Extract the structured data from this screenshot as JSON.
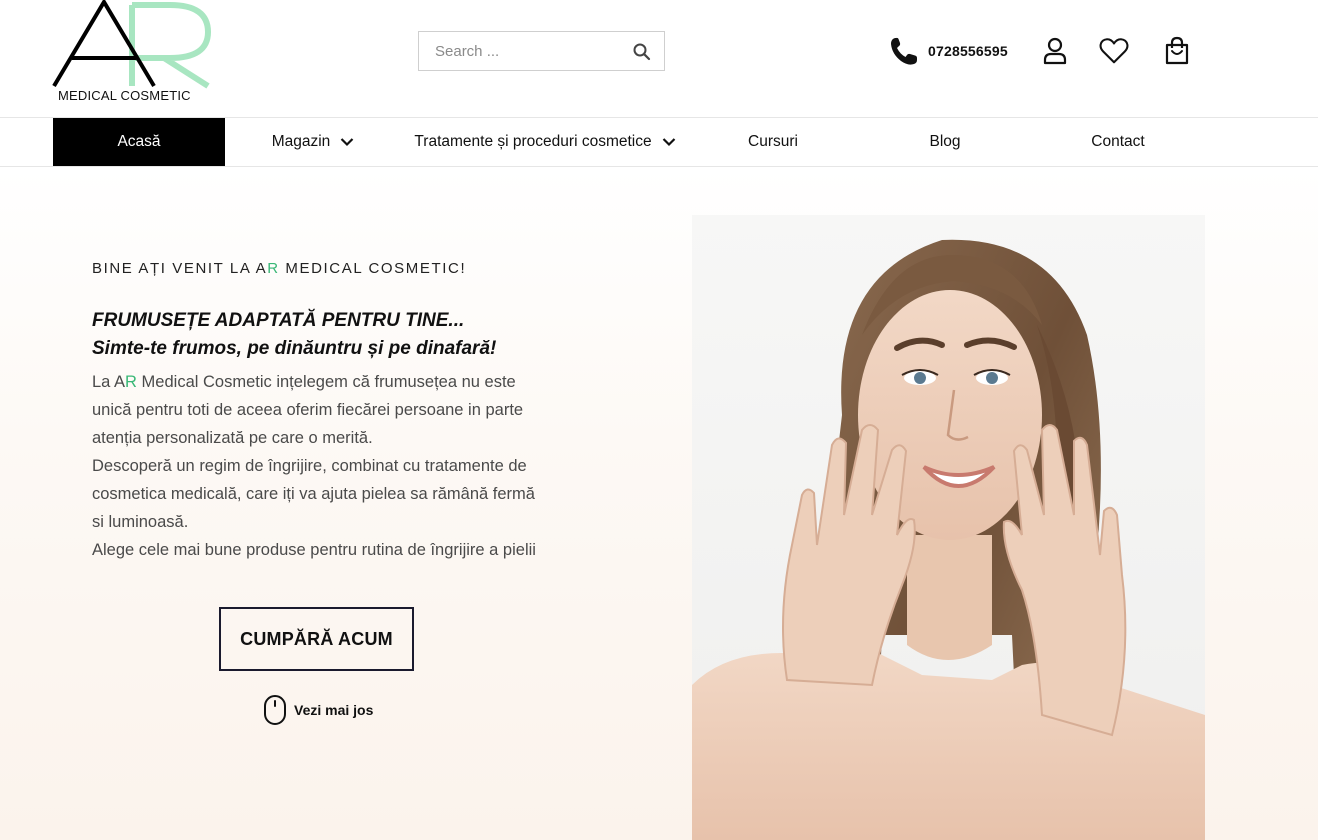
{
  "brand": {
    "logo_letters": "AR",
    "logo_subtitle": "MEDICAL COSMETIC",
    "accent_color": "#a8e6c1",
    "green_text_color": "#39b776"
  },
  "header": {
    "search": {
      "placeholder": "Search ..."
    },
    "phone": {
      "icon": "phone-icon",
      "number": "0728556595"
    },
    "icons": [
      "user-icon",
      "heart-icon",
      "cart-icon"
    ]
  },
  "nav": {
    "items": [
      {
        "label": "Acasă",
        "active": true,
        "dropdown": false
      },
      {
        "label": "Magazin",
        "active": false,
        "dropdown": true
      },
      {
        "label": "Tratamente și proceduri cosmetice",
        "active": false,
        "dropdown": true
      },
      {
        "label": "Cursuri",
        "active": false,
        "dropdown": false
      },
      {
        "label": "Blog",
        "active": false,
        "dropdown": false
      },
      {
        "label": "Contact",
        "active": false,
        "dropdown": false
      }
    ]
  },
  "hero": {
    "welcome_pre": "BINE AȚI VENIT LA A",
    "welcome_r": "R",
    "welcome_post": " MEDICAL COSMETIC!",
    "tagline_1": "FRUMUSEȚE ADAPTATĂ PENTRU TINE...",
    "tagline_2": "Simte-te frumos, pe dinăuntru și pe dinafară!",
    "para1_pre": "La A",
    "para1_r": "R",
    "para1_post": " Medical Cosmetic ințelegem că frumusețea nu este unică pentru toti de aceea oferim fiecărei persoane in parte atenția personalizată pe care o merită.",
    "para2": "Descoperă un regim de îngrijire, combinat cu tratamente de cosmetica medicală, care iți va ajuta pielea sa rămână fermă si luminoasă.",
    "para3": "Alege cele mai bune produse pentru rutina de îngrijire a pielii",
    "cta_label": "CUMPĂRĂ ACUM",
    "scroll_label": "Vezi mai jos",
    "scroll_icon": "mouse-icon"
  }
}
